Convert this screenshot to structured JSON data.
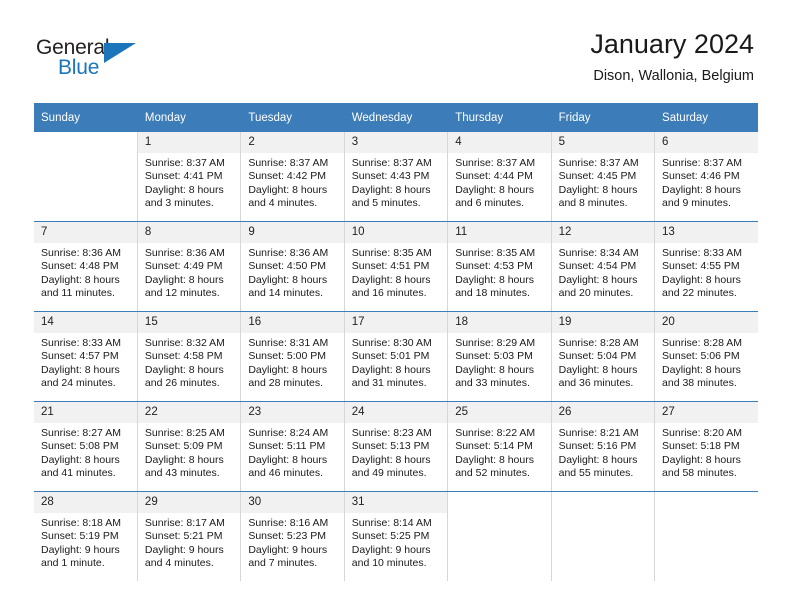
{
  "brand": {
    "name_top": "General",
    "name_bottom": "Blue",
    "accent_color": "#1b75bb"
  },
  "header": {
    "title": "January 2024",
    "subtitle": "Dison, Wallonia, Belgium",
    "header_bg_color": "#3c7cb8",
    "daynum_bg_color": "#f1f1f1"
  },
  "weekday_headers": [
    "Sunday",
    "Monday",
    "Tuesday",
    "Wednesday",
    "Thursday",
    "Friday",
    "Saturday"
  ],
  "weeks": [
    [
      {
        "day": "",
        "sunrise": "",
        "sunset": "",
        "daylight1": "",
        "daylight2": "",
        "blank": true
      },
      {
        "day": "1",
        "sunrise": "Sunrise: 8:37 AM",
        "sunset": "Sunset: 4:41 PM",
        "daylight1": "Daylight: 8 hours",
        "daylight2": "and 3 minutes."
      },
      {
        "day": "2",
        "sunrise": "Sunrise: 8:37 AM",
        "sunset": "Sunset: 4:42 PM",
        "daylight1": "Daylight: 8 hours",
        "daylight2": "and 4 minutes."
      },
      {
        "day": "3",
        "sunrise": "Sunrise: 8:37 AM",
        "sunset": "Sunset: 4:43 PM",
        "daylight1": "Daylight: 8 hours",
        "daylight2": "and 5 minutes."
      },
      {
        "day": "4",
        "sunrise": "Sunrise: 8:37 AM",
        "sunset": "Sunset: 4:44 PM",
        "daylight1": "Daylight: 8 hours",
        "daylight2": "and 6 minutes."
      },
      {
        "day": "5",
        "sunrise": "Sunrise: 8:37 AM",
        "sunset": "Sunset: 4:45 PM",
        "daylight1": "Daylight: 8 hours",
        "daylight2": "and 8 minutes."
      },
      {
        "day": "6",
        "sunrise": "Sunrise: 8:37 AM",
        "sunset": "Sunset: 4:46 PM",
        "daylight1": "Daylight: 8 hours",
        "daylight2": "and 9 minutes."
      }
    ],
    [
      {
        "day": "7",
        "sunrise": "Sunrise: 8:36 AM",
        "sunset": "Sunset: 4:48 PM",
        "daylight1": "Daylight: 8 hours",
        "daylight2": "and 11 minutes."
      },
      {
        "day": "8",
        "sunrise": "Sunrise: 8:36 AM",
        "sunset": "Sunset: 4:49 PM",
        "daylight1": "Daylight: 8 hours",
        "daylight2": "and 12 minutes."
      },
      {
        "day": "9",
        "sunrise": "Sunrise: 8:36 AM",
        "sunset": "Sunset: 4:50 PM",
        "daylight1": "Daylight: 8 hours",
        "daylight2": "and 14 minutes."
      },
      {
        "day": "10",
        "sunrise": "Sunrise: 8:35 AM",
        "sunset": "Sunset: 4:51 PM",
        "daylight1": "Daylight: 8 hours",
        "daylight2": "and 16 minutes."
      },
      {
        "day": "11",
        "sunrise": "Sunrise: 8:35 AM",
        "sunset": "Sunset: 4:53 PM",
        "daylight1": "Daylight: 8 hours",
        "daylight2": "and 18 minutes."
      },
      {
        "day": "12",
        "sunrise": "Sunrise: 8:34 AM",
        "sunset": "Sunset: 4:54 PM",
        "daylight1": "Daylight: 8 hours",
        "daylight2": "and 20 minutes."
      },
      {
        "day": "13",
        "sunrise": "Sunrise: 8:33 AM",
        "sunset": "Sunset: 4:55 PM",
        "daylight1": "Daylight: 8 hours",
        "daylight2": "and 22 minutes."
      }
    ],
    [
      {
        "day": "14",
        "sunrise": "Sunrise: 8:33 AM",
        "sunset": "Sunset: 4:57 PM",
        "daylight1": "Daylight: 8 hours",
        "daylight2": "and 24 minutes."
      },
      {
        "day": "15",
        "sunrise": "Sunrise: 8:32 AM",
        "sunset": "Sunset: 4:58 PM",
        "daylight1": "Daylight: 8 hours",
        "daylight2": "and 26 minutes."
      },
      {
        "day": "16",
        "sunrise": "Sunrise: 8:31 AM",
        "sunset": "Sunset: 5:00 PM",
        "daylight1": "Daylight: 8 hours",
        "daylight2": "and 28 minutes."
      },
      {
        "day": "17",
        "sunrise": "Sunrise: 8:30 AM",
        "sunset": "Sunset: 5:01 PM",
        "daylight1": "Daylight: 8 hours",
        "daylight2": "and 31 minutes."
      },
      {
        "day": "18",
        "sunrise": "Sunrise: 8:29 AM",
        "sunset": "Sunset: 5:03 PM",
        "daylight1": "Daylight: 8 hours",
        "daylight2": "and 33 minutes."
      },
      {
        "day": "19",
        "sunrise": "Sunrise: 8:28 AM",
        "sunset": "Sunset: 5:04 PM",
        "daylight1": "Daylight: 8 hours",
        "daylight2": "and 36 minutes."
      },
      {
        "day": "20",
        "sunrise": "Sunrise: 8:28 AM",
        "sunset": "Sunset: 5:06 PM",
        "daylight1": "Daylight: 8 hours",
        "daylight2": "and 38 minutes."
      }
    ],
    [
      {
        "day": "21",
        "sunrise": "Sunrise: 8:27 AM",
        "sunset": "Sunset: 5:08 PM",
        "daylight1": "Daylight: 8 hours",
        "daylight2": "and 41 minutes."
      },
      {
        "day": "22",
        "sunrise": "Sunrise: 8:25 AM",
        "sunset": "Sunset: 5:09 PM",
        "daylight1": "Daylight: 8 hours",
        "daylight2": "and 43 minutes."
      },
      {
        "day": "23",
        "sunrise": "Sunrise: 8:24 AM",
        "sunset": "Sunset: 5:11 PM",
        "daylight1": "Daylight: 8 hours",
        "daylight2": "and 46 minutes."
      },
      {
        "day": "24",
        "sunrise": "Sunrise: 8:23 AM",
        "sunset": "Sunset: 5:13 PM",
        "daylight1": "Daylight: 8 hours",
        "daylight2": "and 49 minutes."
      },
      {
        "day": "25",
        "sunrise": "Sunrise: 8:22 AM",
        "sunset": "Sunset: 5:14 PM",
        "daylight1": "Daylight: 8 hours",
        "daylight2": "and 52 minutes."
      },
      {
        "day": "26",
        "sunrise": "Sunrise: 8:21 AM",
        "sunset": "Sunset: 5:16 PM",
        "daylight1": "Daylight: 8 hours",
        "daylight2": "and 55 minutes."
      },
      {
        "day": "27",
        "sunrise": "Sunrise: 8:20 AM",
        "sunset": "Sunset: 5:18 PM",
        "daylight1": "Daylight: 8 hours",
        "daylight2": "and 58 minutes."
      }
    ],
    [
      {
        "day": "28",
        "sunrise": "Sunrise: 8:18 AM",
        "sunset": "Sunset: 5:19 PM",
        "daylight1": "Daylight: 9 hours",
        "daylight2": "and 1 minute."
      },
      {
        "day": "29",
        "sunrise": "Sunrise: 8:17 AM",
        "sunset": "Sunset: 5:21 PM",
        "daylight1": "Daylight: 9 hours",
        "daylight2": "and 4 minutes."
      },
      {
        "day": "30",
        "sunrise": "Sunrise: 8:16 AM",
        "sunset": "Sunset: 5:23 PM",
        "daylight1": "Daylight: 9 hours",
        "daylight2": "and 7 minutes."
      },
      {
        "day": "31",
        "sunrise": "Sunrise: 8:14 AM",
        "sunset": "Sunset: 5:25 PM",
        "daylight1": "Daylight: 9 hours",
        "daylight2": "and 10 minutes."
      },
      {
        "day": "",
        "sunrise": "",
        "sunset": "",
        "daylight1": "",
        "daylight2": "",
        "blank": true
      },
      {
        "day": "",
        "sunrise": "",
        "sunset": "",
        "daylight1": "",
        "daylight2": "",
        "blank": true
      },
      {
        "day": "",
        "sunrise": "",
        "sunset": "",
        "daylight1": "",
        "daylight2": "",
        "blank": true
      }
    ]
  ]
}
